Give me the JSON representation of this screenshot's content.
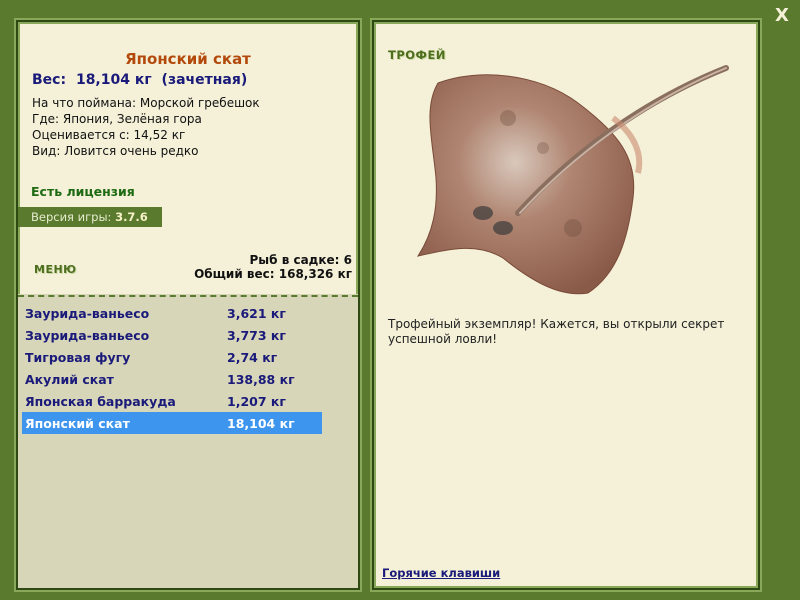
{
  "window": {
    "close_label": "X"
  },
  "fish": {
    "title": "Японский скат",
    "weight_label": "Вес:",
    "weight_value": "18,104 кг",
    "weight_note": "(зачетная)",
    "info": [
      "На что поймана: Морской гребешок",
      "Где: Япония, Зелёная гора",
      "Оценивается с: 14,52 кг",
      "Вид: Ловится очень редко"
    ]
  },
  "license_text": "Есть лицензия",
  "version": {
    "label": "Версия игры:",
    "value": "3.7.6"
  },
  "menu_label": "МЕНЮ",
  "keepnet": {
    "count_text": "Рыб в садке: 6",
    "total_text": "Общий вес: 168,326 кг"
  },
  "fish_list": [
    {
      "name": "Заурида-ваньесо",
      "weight": "3,621 кг"
    },
    {
      "name": "Заурида-ваньесо",
      "weight": "3,773 кг"
    },
    {
      "name": "Тигровая фугу",
      "weight": "2,74 кг"
    },
    {
      "name": "Акулий скат",
      "weight": "138,88 кг"
    },
    {
      "name": "Японская барракуда",
      "weight": "1,207 кг"
    },
    {
      "name": "Японский скат",
      "weight": "18,104 кг"
    }
  ],
  "selected_index": 5,
  "trophy": {
    "label": "ТРОФЕЙ",
    "description": "Трофейный экземпляр! Кажется, вы открыли секрет успешной ловли!"
  },
  "hotkeys_link": "Горячие клавиши",
  "colors": {
    "frame": "#5a7a2e",
    "panel": "#f4f1d8",
    "selection": "#3d95ee",
    "title": "#b34a0c"
  }
}
